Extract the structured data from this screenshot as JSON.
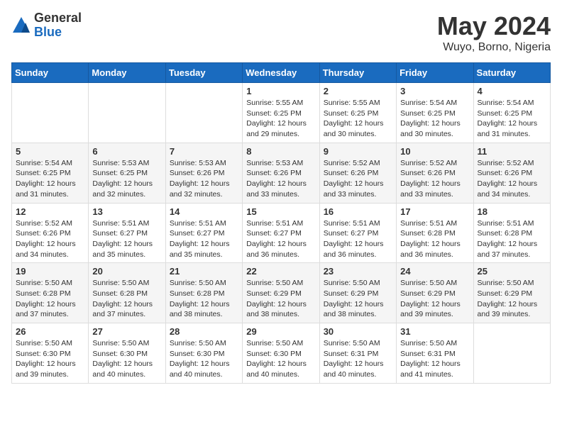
{
  "header": {
    "logo_general": "General",
    "logo_blue": "Blue",
    "month_year": "May 2024",
    "location": "Wuyo, Borno, Nigeria"
  },
  "calendar": {
    "days_of_week": [
      "Sunday",
      "Monday",
      "Tuesday",
      "Wednesday",
      "Thursday",
      "Friday",
      "Saturday"
    ],
    "weeks": [
      [
        {
          "day": "",
          "info": ""
        },
        {
          "day": "",
          "info": ""
        },
        {
          "day": "",
          "info": ""
        },
        {
          "day": "1",
          "info": "Sunrise: 5:55 AM\nSunset: 6:25 PM\nDaylight: 12 hours\nand 29 minutes."
        },
        {
          "day": "2",
          "info": "Sunrise: 5:55 AM\nSunset: 6:25 PM\nDaylight: 12 hours\nand 30 minutes."
        },
        {
          "day": "3",
          "info": "Sunrise: 5:54 AM\nSunset: 6:25 PM\nDaylight: 12 hours\nand 30 minutes."
        },
        {
          "day": "4",
          "info": "Sunrise: 5:54 AM\nSunset: 6:25 PM\nDaylight: 12 hours\nand 31 minutes."
        }
      ],
      [
        {
          "day": "5",
          "info": "Sunrise: 5:54 AM\nSunset: 6:25 PM\nDaylight: 12 hours\nand 31 minutes."
        },
        {
          "day": "6",
          "info": "Sunrise: 5:53 AM\nSunset: 6:25 PM\nDaylight: 12 hours\nand 32 minutes."
        },
        {
          "day": "7",
          "info": "Sunrise: 5:53 AM\nSunset: 6:26 PM\nDaylight: 12 hours\nand 32 minutes."
        },
        {
          "day": "8",
          "info": "Sunrise: 5:53 AM\nSunset: 6:26 PM\nDaylight: 12 hours\nand 33 minutes."
        },
        {
          "day": "9",
          "info": "Sunrise: 5:52 AM\nSunset: 6:26 PM\nDaylight: 12 hours\nand 33 minutes."
        },
        {
          "day": "10",
          "info": "Sunrise: 5:52 AM\nSunset: 6:26 PM\nDaylight: 12 hours\nand 33 minutes."
        },
        {
          "day": "11",
          "info": "Sunrise: 5:52 AM\nSunset: 6:26 PM\nDaylight: 12 hours\nand 34 minutes."
        }
      ],
      [
        {
          "day": "12",
          "info": "Sunrise: 5:52 AM\nSunset: 6:26 PM\nDaylight: 12 hours\nand 34 minutes."
        },
        {
          "day": "13",
          "info": "Sunrise: 5:51 AM\nSunset: 6:27 PM\nDaylight: 12 hours\nand 35 minutes."
        },
        {
          "day": "14",
          "info": "Sunrise: 5:51 AM\nSunset: 6:27 PM\nDaylight: 12 hours\nand 35 minutes."
        },
        {
          "day": "15",
          "info": "Sunrise: 5:51 AM\nSunset: 6:27 PM\nDaylight: 12 hours\nand 36 minutes."
        },
        {
          "day": "16",
          "info": "Sunrise: 5:51 AM\nSunset: 6:27 PM\nDaylight: 12 hours\nand 36 minutes."
        },
        {
          "day": "17",
          "info": "Sunrise: 5:51 AM\nSunset: 6:28 PM\nDaylight: 12 hours\nand 36 minutes."
        },
        {
          "day": "18",
          "info": "Sunrise: 5:51 AM\nSunset: 6:28 PM\nDaylight: 12 hours\nand 37 minutes."
        }
      ],
      [
        {
          "day": "19",
          "info": "Sunrise: 5:50 AM\nSunset: 6:28 PM\nDaylight: 12 hours\nand 37 minutes."
        },
        {
          "day": "20",
          "info": "Sunrise: 5:50 AM\nSunset: 6:28 PM\nDaylight: 12 hours\nand 37 minutes."
        },
        {
          "day": "21",
          "info": "Sunrise: 5:50 AM\nSunset: 6:28 PM\nDaylight: 12 hours\nand 38 minutes."
        },
        {
          "day": "22",
          "info": "Sunrise: 5:50 AM\nSunset: 6:29 PM\nDaylight: 12 hours\nand 38 minutes."
        },
        {
          "day": "23",
          "info": "Sunrise: 5:50 AM\nSunset: 6:29 PM\nDaylight: 12 hours\nand 38 minutes."
        },
        {
          "day": "24",
          "info": "Sunrise: 5:50 AM\nSunset: 6:29 PM\nDaylight: 12 hours\nand 39 minutes."
        },
        {
          "day": "25",
          "info": "Sunrise: 5:50 AM\nSunset: 6:29 PM\nDaylight: 12 hours\nand 39 minutes."
        }
      ],
      [
        {
          "day": "26",
          "info": "Sunrise: 5:50 AM\nSunset: 6:30 PM\nDaylight: 12 hours\nand 39 minutes."
        },
        {
          "day": "27",
          "info": "Sunrise: 5:50 AM\nSunset: 6:30 PM\nDaylight: 12 hours\nand 40 minutes."
        },
        {
          "day": "28",
          "info": "Sunrise: 5:50 AM\nSunset: 6:30 PM\nDaylight: 12 hours\nand 40 minutes."
        },
        {
          "day": "29",
          "info": "Sunrise: 5:50 AM\nSunset: 6:30 PM\nDaylight: 12 hours\nand 40 minutes."
        },
        {
          "day": "30",
          "info": "Sunrise: 5:50 AM\nSunset: 6:31 PM\nDaylight: 12 hours\nand 40 minutes."
        },
        {
          "day": "31",
          "info": "Sunrise: 5:50 AM\nSunset: 6:31 PM\nDaylight: 12 hours\nand 41 minutes."
        },
        {
          "day": "",
          "info": ""
        }
      ]
    ]
  }
}
